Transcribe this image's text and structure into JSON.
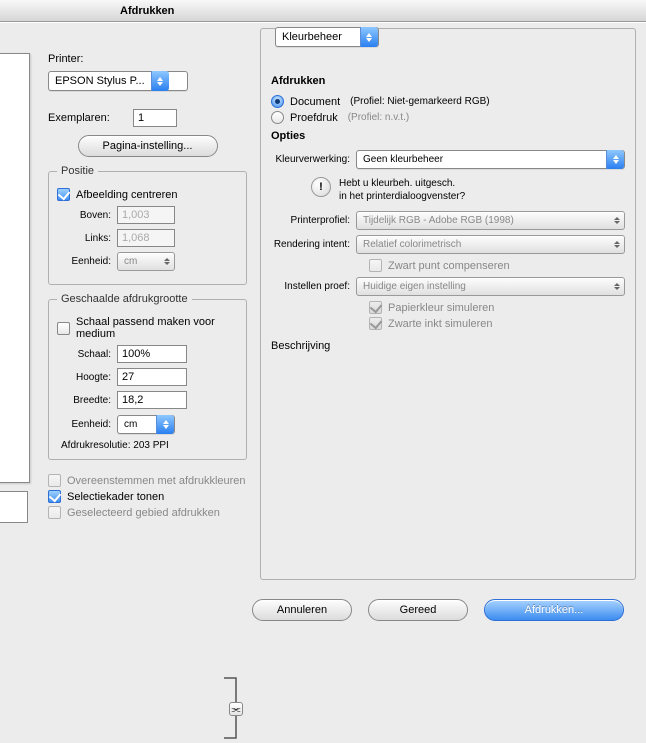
{
  "window": {
    "title": "Afdrukken"
  },
  "left": {
    "printer_label": "Printer:",
    "printer_value": "EPSON Stylus P...",
    "copies_label": "Exemplaren:",
    "copies_value": "1",
    "page_setup_label": "Pagina-instelling...",
    "position": {
      "legend": "Positie",
      "center_label": "Afbeelding centreren",
      "center_on": true,
      "top_label": "Boven:",
      "top_value": "1,003",
      "left_label": "Links:",
      "left_value": "1,068",
      "unit_label": "Eenheid:",
      "unit_value": "cm"
    },
    "scaled": {
      "legend": "Geschaalde afdrukgrootte",
      "fit_label": "Schaal passend maken voor medium",
      "fit_on": false,
      "scale_label": "Schaal:",
      "scale_value": "100%",
      "height_label": "Hoogte:",
      "height_value": "27",
      "width_label": "Breedte:",
      "width_value": "18,2",
      "unit_label": "Eenheid:",
      "unit_value": "cm",
      "resolution_text": "Afdrukresolutie: 203 PPI"
    },
    "match_colors_label": "Overeenstemmen met afdrukkleuren",
    "match_colors_on": false,
    "show_bbox_label": "Selectiekader tonen",
    "show_bbox_on": true,
    "print_selection_label": "Geselecteerd gebied afdrukken",
    "print_selection_on": false
  },
  "right": {
    "tab_label": "Kleurbeheer",
    "print_section_title": "Afdrukken",
    "doc_label": "Document",
    "doc_profile": "(Profiel: Niet-gemarkeerd RGB)",
    "proof_label": "Proefdruk",
    "proof_profile": "(Profiel: n.v.t.)",
    "options_title": "Opties",
    "color_handling_label": "Kleurverwerking:",
    "color_handling_value": "Geen kleurbeheer",
    "warn_line1": "Hebt u kleurbeh. uitgesch.",
    "warn_line2": "in het printerdialoogvenster?",
    "printer_profile_label": "Printerprofiel:",
    "printer_profile_value": "Tijdelijk RGB - Adobe RGB (1998)",
    "rendering_label": "Rendering intent:",
    "rendering_value": "Relatief colorimetrisch",
    "blackpoint_label": "Zwart punt compenseren",
    "proof_setup_label": "Instellen proef:",
    "proof_setup_value": "Huidige eigen instelling",
    "simulate_paper_label": "Papierkleur simuleren",
    "simulate_black_label": "Zwarte inkt simuleren",
    "description_title": "Beschrijving"
  },
  "buttons": {
    "cancel": "Annuleren",
    "done": "Gereed",
    "print": "Afdrukken..."
  }
}
